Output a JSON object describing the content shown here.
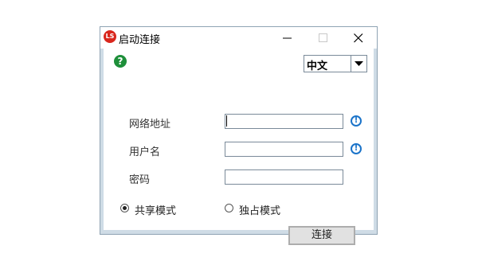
{
  "window": {
    "title": "启动连接",
    "app_icon_text": "LS"
  },
  "header": {
    "help_icon": "?",
    "language": {
      "selected": "中文"
    }
  },
  "form": {
    "address_label": "网络地址",
    "address_value": "",
    "username_label": "用户名",
    "username_value": "",
    "password_label": "密码",
    "password_value": "",
    "info_icon": "!"
  },
  "mode": {
    "shared_label": "共享模式",
    "exclusive_label": "独占模式",
    "selected": "shared"
  },
  "actions": {
    "connect_label": "连接"
  },
  "colors": {
    "help_green": "#1e8f3a",
    "info_blue": "#1a73c9",
    "app_red": "#d9261c"
  }
}
